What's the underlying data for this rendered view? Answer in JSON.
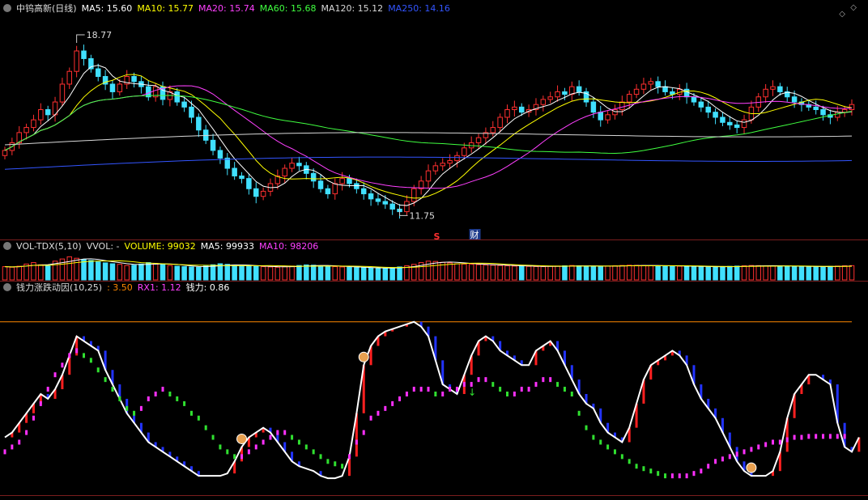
{
  "price_panel": {
    "title": "中钨高新(日线)",
    "ma_legend": [
      {
        "label": "MA5: 15.60",
        "color": "#ffffff"
      },
      {
        "label": "MA10: 15.77",
        "color": "#ffff00"
      },
      {
        "label": "MA20: 15.74",
        "color": "#ff40ff"
      },
      {
        "label": "MA60: 15.68",
        "color": "#40ff40"
      },
      {
        "label": "MA120: 15.12",
        "color": "#d8d8d8"
      },
      {
        "label": "MA250: 14.16",
        "color": "#3355ff"
      }
    ],
    "high_label": "18.77",
    "low_label": "11.75",
    "marker_s": "S",
    "marker_cai": "财"
  },
  "volume_panel": {
    "legend": [
      {
        "label": "VOL-TDX(5,10)",
        "color": "#dddddd"
      },
      {
        "label": "VVOL: -",
        "color": "#dddddd"
      },
      {
        "label": "VOLUME: 99032",
        "color": "#ffff00"
      },
      {
        "label": "MA5: 99933",
        "color": "#ffffff"
      },
      {
        "label": "MA10: 98206",
        "color": "#ff40ff"
      }
    ]
  },
  "indicator_panel": {
    "legend": [
      {
        "label": "钱力涨跌动因(10,25)",
        "color": "#dddddd"
      },
      {
        "label": ": 3.50",
        "color": "#ff8800"
      },
      {
        "label": "RX1: 1.12",
        "color": "#ff40ff"
      },
      {
        "label": "钱力: 0.86",
        "color": "#ffffff"
      }
    ]
  },
  "chart_data": [
    {
      "type": "candlestick",
      "title": "中钨高新(日线)",
      "ylim": [
        11.0,
        19.5
      ],
      "annotations": {
        "max": 18.77,
        "min": 11.75
      },
      "close": [
        14.3,
        14.6,
        15.0,
        15.2,
        15.5,
        15.9,
        15.7,
        16.2,
        16.9,
        17.4,
        18.2,
        17.9,
        17.5,
        17.2,
        16.9,
        16.6,
        16.9,
        17.2,
        17.0,
        16.8,
        16.4,
        16.8,
        16.3,
        16.6,
        16.2,
        16.0,
        15.6,
        15.1,
        14.7,
        14.3,
        14.0,
        13.6,
        13.3,
        13.2,
        12.8,
        12.5,
        12.7,
        13.0,
        13.3,
        13.6,
        13.8,
        13.7,
        13.4,
        13.1,
        12.8,
        12.6,
        13.0,
        13.2,
        13.0,
        12.8,
        12.6,
        12.4,
        12.3,
        12.2,
        12.0,
        11.9,
        12.3,
        12.8,
        13.1,
        13.5,
        13.7,
        13.8,
        13.9,
        14.1,
        14.4,
        14.6,
        14.8,
        15.0,
        15.2,
        15.6,
        15.9,
        16.0,
        15.8,
        15.9,
        16.1,
        16.3,
        16.4,
        16.6,
        16.5,
        16.8,
        16.6,
        16.2,
        15.8,
        15.5,
        15.7,
        15.9,
        16.2,
        16.5,
        16.7,
        16.9,
        17.0,
        16.8,
        16.6,
        16.5,
        16.7,
        16.4,
        16.2,
        16.0,
        15.8,
        15.6,
        15.4,
        15.3,
        15.2,
        15.5,
        16.0,
        16.4,
        16.7,
        16.8,
        16.6,
        16.4,
        16.2,
        16.1,
        16.0,
        15.9,
        15.7,
        15.6,
        15.8,
        15.9,
        16.1
      ],
      "ma_values": {
        "MA5": 15.6,
        "MA10": 15.77,
        "MA20": 15.74,
        "MA60": 15.68,
        "MA120": 15.12,
        "MA250": 14.16
      }
    },
    {
      "type": "bar",
      "title": "VOL-TDX(5,10)",
      "values": [
        92,
        88,
        95,
        110,
        120,
        105,
        98,
        130,
        145,
        160,
        150,
        140,
        135,
        125,
        118,
        112,
        108,
        100,
        102,
        110,
        120,
        115,
        108,
        100,
        95,
        92,
        90,
        88,
        96,
        105,
        112,
        108,
        100,
        98,
        96,
        94,
        92,
        90,
        88,
        92,
        96,
        100,
        104,
        102,
        98,
        95,
        92,
        90,
        88,
        86,
        84,
        82,
        80,
        82,
        85,
        90,
        98,
        108,
        120,
        130,
        128,
        122,
        118,
        112,
        110,
        108,
        106,
        104,
        102,
        100,
        98,
        96,
        95,
        94,
        93,
        92,
        94,
        96,
        98,
        100,
        98,
        96,
        95,
        94,
        96,
        98,
        100,
        102,
        101,
        100,
        99,
        98,
        97,
        96,
        95,
        94,
        93,
        92,
        91,
        90,
        92,
        94,
        96,
        98,
        100,
        99,
        98,
        97,
        96,
        95,
        94,
        93,
        92,
        91,
        92,
        94,
        96,
        98,
        99
      ],
      "legend_values": {
        "VOLUME": 99032,
        "MA5": 99933,
        "MA10": 98206
      }
    },
    {
      "type": "line",
      "title": "钱力涨跌动因(10,25)",
      "ylim": [
        0,
        4
      ],
      "reference_line": 3.5,
      "series": [
        {
          "name": "钱力",
          "values": [
            1.1,
            1.2,
            1.4,
            1.6,
            1.8,
            2.0,
            1.9,
            2.1,
            2.4,
            2.8,
            3.2,
            3.1,
            3.0,
            2.9,
            2.5,
            2.2,
            1.9,
            1.6,
            1.4,
            1.2,
            1.0,
            0.9,
            0.8,
            0.7,
            0.6,
            0.5,
            0.4,
            0.3,
            0.3,
            0.3,
            0.3,
            0.35,
            0.6,
            0.9,
            1.1,
            1.2,
            1.3,
            1.2,
            1.0,
            0.8,
            0.6,
            0.5,
            0.45,
            0.4,
            0.3,
            0.25,
            0.25,
            0.3,
            0.7,
            1.6,
            2.6,
            3.0,
            3.2,
            3.3,
            3.35,
            3.4,
            3.45,
            3.5,
            3.4,
            3.2,
            2.7,
            2.2,
            2.1,
            2.0,
            2.4,
            2.8,
            3.1,
            3.2,
            3.1,
            2.9,
            2.8,
            2.7,
            2.6,
            2.6,
            2.9,
            3.0,
            3.1,
            2.9,
            2.6,
            2.3,
            2.0,
            1.8,
            1.7,
            1.4,
            1.2,
            1.1,
            1.0,
            1.3,
            1.8,
            2.3,
            2.6,
            2.7,
            2.8,
            2.9,
            2.8,
            2.6,
            2.2,
            1.9,
            1.7,
            1.5,
            1.2,
            0.9,
            0.6,
            0.4,
            0.3,
            0.3,
            0.3,
            0.4,
            0.8,
            1.5,
            2.0,
            2.2,
            2.4,
            2.4,
            2.3,
            2.2,
            1.4,
            0.9,
            0.8,
            1.1
          ]
        },
        {
          "name": "RX1",
          "values": [
            0.8,
            0.9,
            1.0,
            1.2,
            1.5,
            1.8,
            2.1,
            2.4,
            2.6,
            2.8,
            2.9,
            2.8,
            2.7,
            2.5,
            2.3,
            2.1,
            1.9,
            1.7,
            1.6,
            1.7,
            1.9,
            2.0,
            2.1,
            2.0,
            1.9,
            1.8,
            1.6,
            1.5,
            1.3,
            1.1,
            0.9,
            0.8,
            0.7,
            0.7,
            0.8,
            0.9,
            1.0,
            1.1,
            1.2,
            1.2,
            1.1,
            1.0,
            0.9,
            0.8,
            0.7,
            0.6,
            0.55,
            0.5,
            0.7,
            1.0,
            1.2,
            1.5,
            1.6,
            1.7,
            1.8,
            1.9,
            2.0,
            2.1,
            2.1,
            2.1,
            2.0,
            2.0,
            2.1,
            2.1,
            2.2,
            2.2,
            2.3,
            2.3,
            2.2,
            2.1,
            2.0,
            2.0,
            2.1,
            2.1,
            2.2,
            2.3,
            2.3,
            2.2,
            2.1,
            2.0,
            1.6,
            1.3,
            1.1,
            1.0,
            0.9,
            0.8,
            0.7,
            0.6,
            0.5,
            0.45,
            0.4,
            0.35,
            0.3,
            0.3,
            0.3,
            0.3,
            0.35,
            0.4,
            0.5,
            0.6,
            0.65,
            0.7,
            0.75,
            0.8,
            0.85,
            0.9,
            0.95,
            1.0,
            1.0,
            1.05,
            1.1,
            1.1,
            1.12,
            1.12,
            1.12,
            1.12,
            1.12,
            1.12
          ]
        }
      ]
    }
  ]
}
